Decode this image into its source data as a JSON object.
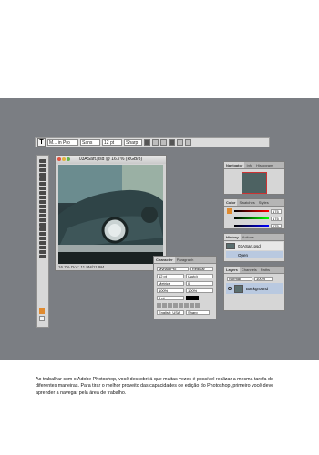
{
  "options_bar": {
    "tool_letter": "T",
    "font_family": "M... in Pro",
    "font_style": "Sans",
    "font_size": "12 pt",
    "aa_mode": "Sharp"
  },
  "document": {
    "title": "03ASart.psd @ 16.7% (RGB/8)",
    "status": "16.7%   Doc: 11.9M/11.9M"
  },
  "navigator": {
    "tabs": [
      "Navigator",
      "Info",
      "Histogram"
    ]
  },
  "color_panel": {
    "tabs": [
      "Color",
      "Swatches",
      "Styles"
    ],
    "r_value": "175",
    "g_value": "175",
    "b_value": "175"
  },
  "history_panel": {
    "tabs": [
      "History",
      "Actions"
    ],
    "items": [
      "03ASart.psd",
      "Open"
    ]
  },
  "character_panel": {
    "tabs": [
      "Character",
      "Paragraph"
    ],
    "font": "Myriad Pro",
    "style": "Regular",
    "size": "12 pt",
    "leading": "(Auto)",
    "kerning": "Metrics",
    "tracking": "0",
    "vscale": "100%",
    "hscale": "100%",
    "baseline": "0 pt",
    "language": "English: USA",
    "antialias": "Sharp"
  },
  "layers_panel": {
    "tabs": [
      "Layers",
      "Channels",
      "Paths"
    ],
    "blend": "Normal",
    "opacity": "100%",
    "layers": [
      "Background"
    ]
  },
  "caption": "Ao trabalhar com o Adobe Photoshop, você descobrirá que muitas vezes é possível realizar a mesma tarefa de diferentes maneiras. Para tirar o melhor proveito das capacidades de edição do Photoshop, primeiro você deve aprender a navegar pela área de trabalho.",
  "colors": {
    "background": "#7b7e83",
    "selection": "#b9c9e0",
    "close_dot": "#e0533f",
    "min_dot": "#e3b33d",
    "max_dot": "#66b24c"
  }
}
